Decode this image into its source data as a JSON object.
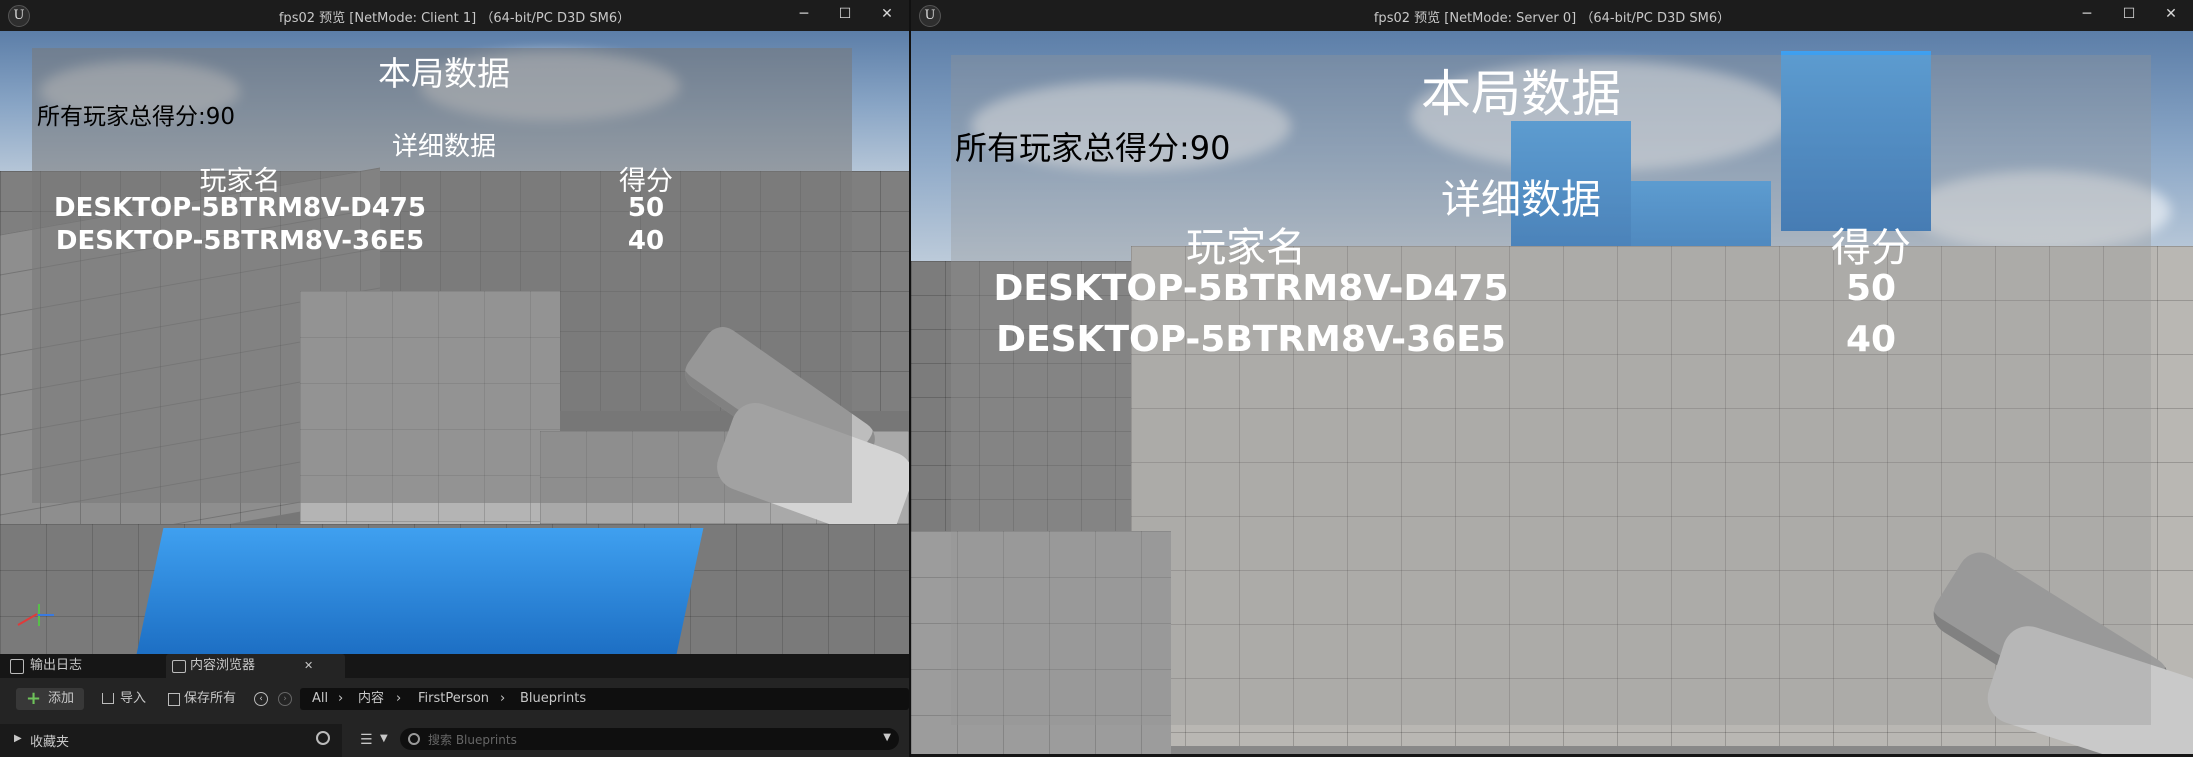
{
  "left_window": {
    "title": "fps02 预览 [NetMode: Client 1] （64-bit/PC D3D SM6）",
    "logo": "U",
    "controls": {
      "minimize": "─",
      "maximize": "☐",
      "close": "✕"
    },
    "hud": {
      "title": "本局数据",
      "total_label": "所有玩家总得分:90",
      "detail_title": "详细数据",
      "col_player": "玩家名",
      "col_score": "得分",
      "rows": [
        {
          "name": "DESKTOP-5BTRM8V-D475",
          "score": "50"
        },
        {
          "name": "DESKTOP-5BTRM8V-36E5",
          "score": "40"
        }
      ]
    },
    "bottom_panel": {
      "tabs": [
        {
          "label": "输出日志",
          "icon": "log-icon"
        },
        {
          "label": "内容浏览器",
          "icon": "content-browser-icon",
          "close": "✕"
        }
      ],
      "add_button": "添加",
      "import_button": "导入",
      "save_all_button": "保存所有",
      "breadcrumb": [
        "All",
        "内容",
        "FirstPerson",
        "Blueprints"
      ],
      "favorites_label": "收藏夹",
      "search_placeholder": "搜索 Blueprints"
    },
    "colors": {
      "add_icon": "#6ec25a",
      "axis_x": "#e03a3a",
      "axis_y": "#58c04a",
      "axis_z": "#3a7ae0"
    }
  },
  "right_window": {
    "title": "fps02 预览 [NetMode: Server 0] （64-bit/PC D3D SM6）",
    "logo": "U",
    "controls": {
      "minimize": "─",
      "maximize": "☐",
      "close": "✕"
    },
    "hud": {
      "title": "本局数据",
      "total_label": "所有玩家总得分:90",
      "detail_title": "详细数据",
      "col_player": "玩家名",
      "col_score": "得分",
      "rows": [
        {
          "name": "DESKTOP-5BTRM8V-D475",
          "score": "50"
        },
        {
          "name": "DESKTOP-5BTRM8V-36E5",
          "score": "40"
        }
      ]
    }
  }
}
